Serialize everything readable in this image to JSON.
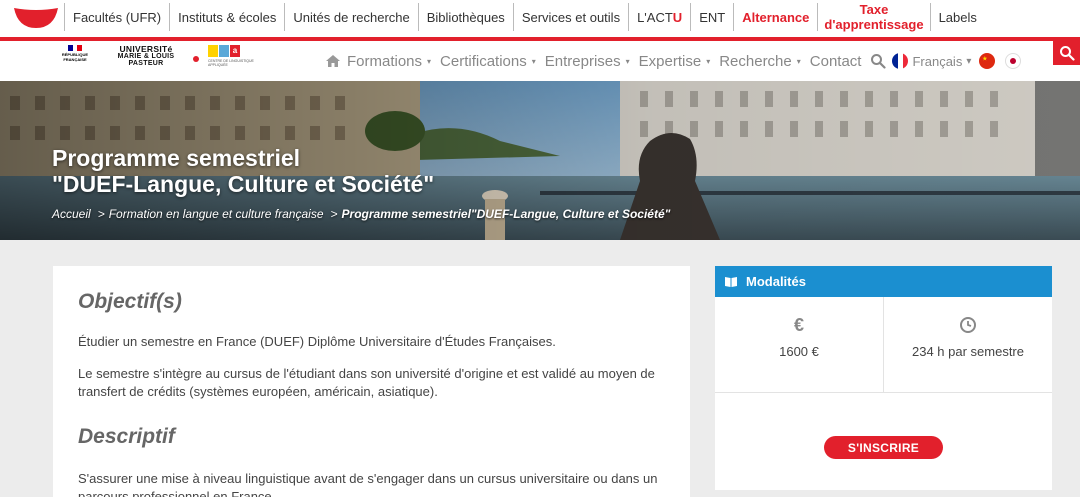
{
  "topbar": {
    "items": [
      {
        "label": "Facultés (UFR)"
      },
      {
        "label": "Instituts & écoles"
      },
      {
        "label": "Unités de recherche"
      },
      {
        "label": "Bibliothèques"
      },
      {
        "label": "Services et outils"
      },
      {
        "label_main": "L'ACT",
        "label_accent": "U"
      },
      {
        "label": "ENT"
      },
      {
        "label": "Alternance"
      },
      {
        "label_line1": "Taxe",
        "label_line2": "d'apprentissage"
      },
      {
        "label": "Labels"
      }
    ]
  },
  "logos": {
    "republique": {
      "line1": "RÉPUBLIQUE",
      "line2": "FRANÇAISE"
    },
    "university": {
      "line1": "UNIVERSITé",
      "line2": "MARIE & LOUIS",
      "line3": "PASTEUR"
    },
    "cla": {
      "letters": [
        "c",
        "l",
        "a"
      ],
      "caption": "CENTRE DE LINGUISTIQUE APPLIQUÉE"
    }
  },
  "mainnav": {
    "items": [
      {
        "label": "Formations"
      },
      {
        "label": "Certifications"
      },
      {
        "label": "Entreprises"
      },
      {
        "label": "Expertise"
      },
      {
        "label": "Recherche"
      },
      {
        "label": "Contact"
      }
    ],
    "language": "Français",
    "language_caret": "▾",
    "caret": "▾"
  },
  "hero": {
    "title_line1": "Programme semestriel",
    "title_line2": "\"DUEF-Langue, Culture et Société\"",
    "breadcrumb": [
      {
        "label": "Accueil"
      },
      {
        "label": "Formation en langue et culture française"
      },
      {
        "label": "Programme semestriel\"DUEF-Langue, Culture et Société\""
      }
    ],
    "separator": ">"
  },
  "content": {
    "heading1": "Objectif(s)",
    "para1": "Étudier un semestre en France (DUEF) Diplôme Universitaire d'Études Françaises.",
    "para2": "Le semestre s'intègre au cursus de l'étudiant dans son université d'origine et est validé au moyen de transfert de crédits (systèmes européen, américain, asiatique).",
    "heading2": "Descriptif",
    "para3": "S'assurer une mise à niveau linguistique avant de s'engager dans un cursus universitaire ou dans un parcours professionnel en France"
  },
  "sidebar": {
    "title": "Modalités",
    "price_icon": "€",
    "price": "1600 €",
    "duration": "234 h par semestre",
    "register_label": "S'INSCRIRE"
  },
  "colors": {
    "brand_red": "#e2202c",
    "accent_blue": "#1b8fd0"
  }
}
